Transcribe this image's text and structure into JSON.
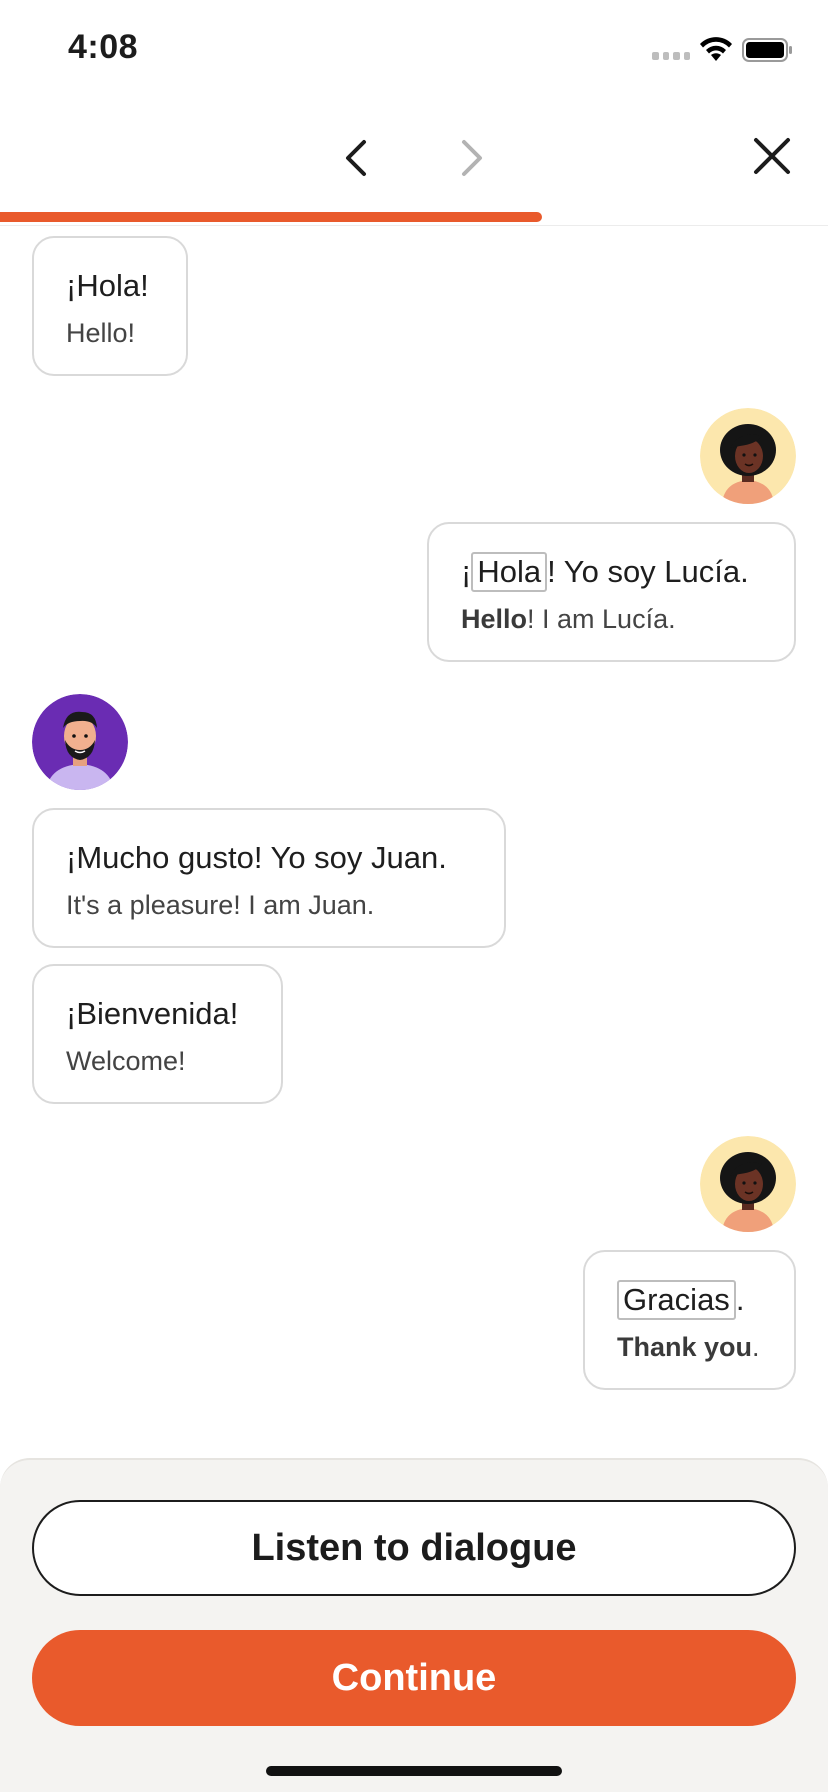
{
  "status_bar": {
    "time": "4:08"
  },
  "progress": {
    "fraction": 0.655
  },
  "colors": {
    "accent": "#e95a2c",
    "border": "#d9d9d9"
  },
  "messages": [
    {
      "speaker": "juan",
      "es": "¡Hola!",
      "en": "Hello!"
    },
    {
      "speaker": "lucia",
      "es_pre": "¡",
      "es_hl": "Hola",
      "es_post": "! Yo soy Lucía.",
      "en_bold": "Hello",
      "en_post": "! I am Lucía."
    },
    {
      "speaker": "juan",
      "es": "¡Mucho gusto! Yo soy Juan.",
      "en": "It's a pleasure! I am Juan."
    },
    {
      "speaker": "juan",
      "es": "¡Bienvenida!",
      "en": "Welcome!"
    },
    {
      "speaker": "lucia",
      "es_hl": "Gracias",
      "es_post": ".",
      "en_bold": "Thank you",
      "en_post": "."
    }
  ],
  "footer": {
    "listen_label": "Listen to dialogue",
    "continue_label": "Continue"
  }
}
